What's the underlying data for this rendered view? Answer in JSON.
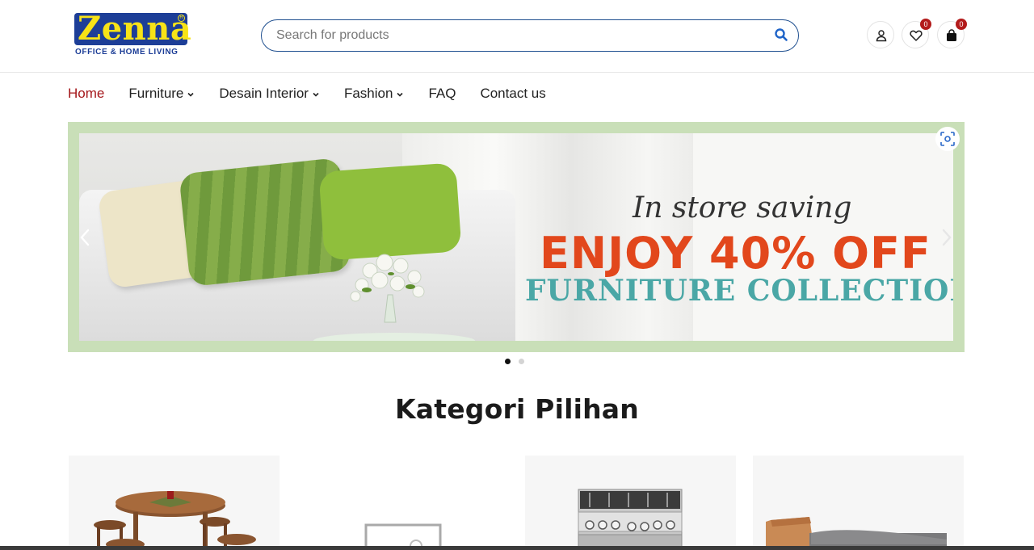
{
  "brand": {
    "name": "Zenna",
    "tagline": "OFFICE & HOME LIVING",
    "registered_mark": "R",
    "colors": {
      "primary": "#1d3e97",
      "accent": "#f7e317"
    }
  },
  "search": {
    "placeholder": "Search for products",
    "value": ""
  },
  "header_actions": {
    "account_icon": "user-icon",
    "wishlist_icon": "heart-icon",
    "wishlist_count": "0",
    "cart_icon": "shopping-bag-icon",
    "cart_count": "0",
    "badge_color": "#b31b1b"
  },
  "nav": {
    "active_color": "#a4161a",
    "items": [
      {
        "label": "Home",
        "active": true,
        "dropdown": false
      },
      {
        "label": "Furniture",
        "active": false,
        "dropdown": true
      },
      {
        "label": "Desain Interior",
        "active": false,
        "dropdown": true
      },
      {
        "label": "Fashion",
        "active": false,
        "dropdown": true
      },
      {
        "label": "FAQ",
        "active": false,
        "dropdown": false
      },
      {
        "label": "Contact us",
        "active": false,
        "dropdown": false
      }
    ]
  },
  "banner": {
    "line1": "In store saving",
    "line2": "ENJOY 40% OFF",
    "line3": "FURNITURE COLLECTION",
    "prev_icon": "chevron-left-icon",
    "next_icon": "chevron-right-icon",
    "zoom_icon": "focus-scan-icon",
    "slides_total": 2,
    "active_slide": 1
  },
  "section": {
    "title": "Kategori Pilihan"
  },
  "categories": [
    {
      "image": "dining-table-set"
    },
    {
      "image": "picture-frame"
    },
    {
      "image": "gas-range-oven"
    },
    {
      "image": "wooden-bed"
    }
  ]
}
